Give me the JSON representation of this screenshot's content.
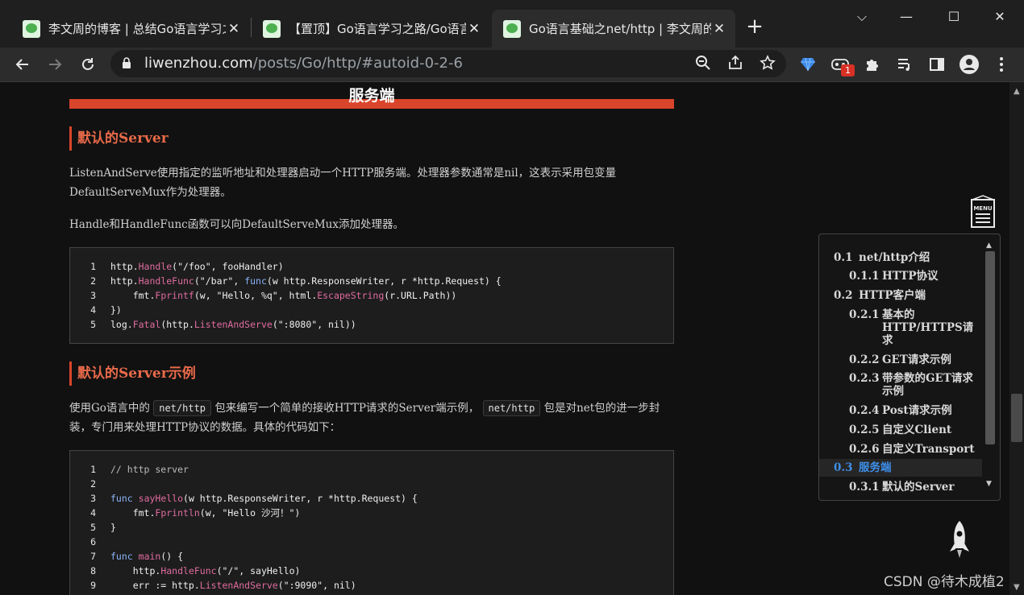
{
  "browser": {
    "tabs": [
      {
        "title": "李文周的博客 | 总结Go语言学习之",
        "close": "✕"
      },
      {
        "title": "【置顶】Go语言学习之路/Go语言",
        "close": "✕"
      },
      {
        "title": "Go语言基础之net/http | 李文周的",
        "close": "✕"
      }
    ],
    "new_tab": "+",
    "window_controls": {
      "dropdown": "⌵",
      "minimize": "—",
      "maximize": "☐",
      "close": "✕"
    },
    "url_host": "liwenzhou.com",
    "url_path": "/posts/Go/http/#autoid-0-2-6",
    "extension_badge": "1"
  },
  "article": {
    "section_title": "服务端",
    "h3_1": "默认的Server",
    "p1_line1": "ListenAndServe使用指定的监听地址和处理器启动一个HTTP服务端。处理器参数通常是nil，这表示采用包变量",
    "p1_line2": "DefaultServeMux作为处理器。",
    "p2": "Handle和HandleFunc函数可以向DefaultServeMux添加处理器。",
    "code1": [
      {
        "n": "1",
        "code": "http.Handle(\"/foo\", fooHandler)"
      },
      {
        "n": "2",
        "code": "http.HandleFunc(\"/bar\", func(w http.ResponseWriter, r *http.Request) {"
      },
      {
        "n": "3",
        "code": "    fmt.Fprintf(w, \"Hello, %q\", html.EscapeString(r.URL.Path))"
      },
      {
        "n": "4",
        "code": "})"
      },
      {
        "n": "5",
        "code": "log.Fatal(http.ListenAndServe(\":8080\", nil))"
      }
    ],
    "h3_2": "默认的Server示例",
    "p3_a": "使用Go语言中的",
    "p3_code1": "net/http",
    "p3_b": "包来编写一个简单的接收HTTP请求的Server端示例，",
    "p3_code2": "net/http",
    "p3_c": "包是对net包的进一步封",
    "p3_line2": "装，专门用来处理HTTP协议的数据。具体的代码如下：",
    "code2": [
      {
        "n": "1",
        "code": "// http server"
      },
      {
        "n": "2",
        "code": ""
      },
      {
        "n": "3",
        "code": "func sayHello(w http.ResponseWriter, r *http.Request) {"
      },
      {
        "n": "4",
        "code": "    fmt.Fprintln(w, \"Hello 沙河！\")"
      },
      {
        "n": "5",
        "code": "}"
      },
      {
        "n": "6",
        "code": ""
      },
      {
        "n": "7",
        "code": "func main() {"
      },
      {
        "n": "8",
        "code": "    http.HandleFunc(\"/\", sayHello)"
      },
      {
        "n": "9",
        "code": "    err := http.ListenAndServe(\":9090\", nil)"
      }
    ]
  },
  "toc": {
    "menu_label": "MENU",
    "items": [
      {
        "num": "0.1",
        "label": "net/http介绍"
      },
      {
        "num": "0.1.1",
        "label": "HTTP协议"
      },
      {
        "num": "0.2",
        "label": "HTTP客户端"
      },
      {
        "num": "0.2.1",
        "label": "基本的\nHTTP/HTTPS请\n求"
      },
      {
        "num": "0.2.2",
        "label": "GET请求示例"
      },
      {
        "num": "0.2.3",
        "label": "带参数的GET请求\n示例"
      },
      {
        "num": "0.2.4",
        "label": "Post请求示例"
      },
      {
        "num": "0.2.5",
        "label": "自定义Client"
      },
      {
        "num": "0.2.6",
        "label": "自定义Transport"
      },
      {
        "num": "0.3",
        "label": "服务端"
      },
      {
        "num": "0.3.1",
        "label": "默认的Server"
      }
    ]
  },
  "watermark": "CSDN @待木成植2"
}
